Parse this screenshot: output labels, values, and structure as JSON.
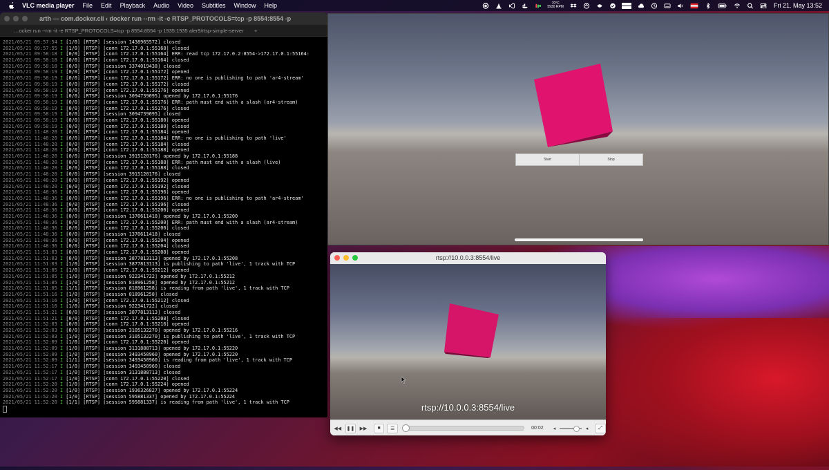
{
  "menubar": {
    "app_name": "VLC media player",
    "items": [
      "File",
      "Edit",
      "Playback",
      "Audio",
      "Video",
      "Subtitles",
      "Window",
      "Help"
    ],
    "temperature": "70°C",
    "fan": "5930 RPM",
    "clock": "Fri 21. May  13:52"
  },
  "terminal": {
    "title": "arth — com.docker.cli ‹ docker run --rm -it -e RTSP_PROTOCOLS=tcp -p 8554:8554 -p",
    "tab": "…ocker run --rm -it -e RTSP_PROTOCOLS=tcp -p 8554:8554 -p 1935:1935 aler9/rtsp-simple-server",
    "plus": "+",
    "lines": [
      [
        "2021/05/21 09:57:54",
        "I",
        "[1/0] [RTSP] [session 1438965572] closed"
      ],
      [
        "2021/05/21 09:57:55",
        "I",
        "[1/0] [RTSP] [conn 172.17.0.1:55168] closed"
      ],
      [
        "2021/05/21 09:58:18",
        "I",
        "[0/0] [RTSP] [conn 172.17.0.1:55164] ERR: read tcp 172.17.0.2:8554->172.17.0.1:55164:"
      ],
      [
        "2021/05/21 09:58:18",
        "I",
        "[0/0] [RTSP] [conn 172.17.0.1:55164] closed"
      ],
      [
        "2021/05/21 09:58:18",
        "I",
        "[0/0] [RTSP] [session 3374019438] closed"
      ],
      [
        "2021/05/21 09:58:19",
        "I",
        "[0/0] [RTSP] [conn 172.17.0.1:55172] opened"
      ],
      [
        "2021/05/21 09:58:19",
        "I",
        "[0/0] [RTSP] [conn 172.17.0.1:55172] ERR: no one is publishing to path 'ar4-stream'"
      ],
      [
        "2021/05/21 09:58:19",
        "I",
        "[0/0] [RTSP] [conn 172.17.0.1:55172] closed"
      ],
      [
        "2021/05/21 09:58:19",
        "I",
        "[0/0] [RTSP] [conn 172.17.0.1:55176] opened"
      ],
      [
        "2021/05/21 09:58:19",
        "I",
        "[0/0] [RTSP] [session 3094739095] opened by 172.17.0.1:55176"
      ],
      [
        "2021/05/21 09:58:19",
        "I",
        "[0/0] [RTSP] [conn 172.17.0.1:55176] ERR: path must end with a slash (ar4-stream)"
      ],
      [
        "2021/05/21 09:58:19",
        "I",
        "[0/0] [RTSP] [conn 172.17.0.1:55176] closed"
      ],
      [
        "2021/05/21 09:58:19",
        "I",
        "[0/0] [RTSP] [session 3094739095] closed"
      ],
      [
        "2021/05/21 09:58:19",
        "I",
        "[0/0] [RTSP] [conn 172.17.0.1:55180] opened"
      ],
      [
        "2021/05/21 09:58:19",
        "I",
        "[0/0] [RTSP] [conn 172.17.0.1:55180] closed"
      ],
      [
        "2021/05/21 11:48:20",
        "I",
        "[0/0] [RTSP] [conn 172.17.0.1:55184] opened"
      ],
      [
        "2021/05/21 11:48:20",
        "I",
        "[0/0] [RTSP] [conn 172.17.0.1:55184] ERR: no one is publishing to path 'live'"
      ],
      [
        "2021/05/21 11:48:20",
        "I",
        "[0/0] [RTSP] [conn 172.17.0.1:55184] closed"
      ],
      [
        "2021/05/21 11:48:20",
        "I",
        "[0/0] [RTSP] [conn 172.17.0.1:55188] opened"
      ],
      [
        "2021/05/21 11:48:20",
        "I",
        "[0/0] [RTSP] [session 3915120176] opened by 172.17.0.1:55188"
      ],
      [
        "2021/05/21 11:48:20",
        "I",
        "[0/0] [RTSP] [conn 172.17.0.1:55188] ERR: path must end with a slash (live)"
      ],
      [
        "2021/05/21 11:48:20",
        "I",
        "[0/0] [RTSP] [conn 172.17.0.1:55188] closed"
      ],
      [
        "2021/05/21 11:48:20",
        "I",
        "[0/0] [RTSP] [session 3915120176] closed"
      ],
      [
        "2021/05/21 11:48:20",
        "I",
        "[0/0] [RTSP] [conn 172.17.0.1:55192] opened"
      ],
      [
        "2021/05/21 11:48:20",
        "I",
        "[0/0] [RTSP] [conn 172.17.0.1:55192] closed"
      ],
      [
        "2021/05/21 11:48:36",
        "I",
        "[0/0] [RTSP] [conn 172.17.0.1:55196] opened"
      ],
      [
        "2021/05/21 11:48:36",
        "I",
        "[0/0] [RTSP] [conn 172.17.0.1:55196] ERR: no one is publishing to path 'ar4-stream'"
      ],
      [
        "2021/05/21 11:48:36",
        "I",
        "[0/0] [RTSP] [conn 172.17.0.1:55196] closed"
      ],
      [
        "2021/05/21 11:48:36",
        "I",
        "[0/0] [RTSP] [conn 172.17.0.1:55200] opened"
      ],
      [
        "2021/05/21 11:48:36",
        "I",
        "[0/0] [RTSP] [session 1370611418] opened by 172.17.0.1:55200"
      ],
      [
        "2021/05/21 11:48:36",
        "I",
        "[0/0] [RTSP] [conn 172.17.0.1:55200] ERR: path must end with a slash (ar4-stream)"
      ],
      [
        "2021/05/21 11:48:36",
        "I",
        "[0/0] [RTSP] [conn 172.17.0.1:55200] closed"
      ],
      [
        "2021/05/21 11:48:36",
        "I",
        "[0/0] [RTSP] [session 1370611418] closed"
      ],
      [
        "2021/05/21 11:48:36",
        "I",
        "[0/0] [RTSP] [conn 172.17.0.1:55204] opened"
      ],
      [
        "2021/05/21 11:48:36",
        "I",
        "[0/0] [RTSP] [conn 172.17.0.1:55204] closed"
      ],
      [
        "2021/05/21 11:51:03",
        "I",
        "[0/0] [RTSP] [conn 172.17.0.1:55208] opened"
      ],
      [
        "2021/05/21 11:51:03",
        "I",
        "[0/0] [RTSP] [session 3877813113] opened by 172.17.0.1:55208"
      ],
      [
        "2021/05/21 11:51:03",
        "I",
        "[1/0] [RTSP] [session 3877813113] is publishing to path 'live', 1 track with TCP"
      ],
      [
        "2021/05/21 11:51:05",
        "I",
        "[1/0] [RTSP] [conn 172.17.0.1:55212] opened"
      ],
      [
        "2021/05/21 11:51:05",
        "I",
        "[1/0] [RTSP] [session 922341722] opened by 172.17.0.1:55212"
      ],
      [
        "2021/05/21 11:51:05",
        "I",
        "[1/0] [RTSP] [session 818961258] opened by 172.17.0.1:55212"
      ],
      [
        "2021/05/21 11:51:05",
        "I",
        "[1/1] [RTSP] [session 818961258] is reading from path 'live', 1 track with TCP"
      ],
      [
        "2021/05/21 11:51:16",
        "I",
        "[1/0] [RTSP] [session 818961258] closed"
      ],
      [
        "2021/05/21 11:51:16",
        "I",
        "[1/0] [RTSP] [conn 172.17.0.1:55212] closed"
      ],
      [
        "2021/05/21 11:51:16",
        "I",
        "[1/0] [RTSP] [session 922341722] closed"
      ],
      [
        "2021/05/21 11:51:21",
        "I",
        "[0/0] [RTSP] [session 3877813113] closed"
      ],
      [
        "2021/05/21 11:51:21",
        "I",
        "[0/0] [RTSP] [conn 172.17.0.1:55208] closed"
      ],
      [
        "2021/05/21 11:52:03",
        "I",
        "[0/0] [RTSP] [conn 172.17.0.1:55216] opened"
      ],
      [
        "2021/05/21 11:52:03",
        "I",
        "[0/0] [RTSP] [session 3105132270] opened by 172.17.0.1:55216"
      ],
      [
        "2021/05/21 11:52:03",
        "I",
        "[1/0] [RTSP] [session 3105132270] is publishing to path 'live', 1 track with TCP"
      ],
      [
        "2021/05/21 11:52:09",
        "I",
        "[1/0] [RTSP] [conn 172.17.0.1:55220] opened"
      ],
      [
        "2021/05/21 11:52:09",
        "I",
        "[1/0] [RTSP] [session 3131888713] opened by 172.17.0.1:55220"
      ],
      [
        "2021/05/21 11:52:09",
        "I",
        "[1/0] [RTSP] [session 3493450960] opened by 172.17.0.1:55220"
      ],
      [
        "2021/05/21 11:52:09",
        "I",
        "[1/1] [RTSP] [session 3493450960] is reading from path 'live', 1 track with TCP"
      ],
      [
        "2021/05/21 11:52:17",
        "I",
        "[1/0] [RTSP] [session 3493450960] closed"
      ],
      [
        "2021/05/21 11:52:17",
        "I",
        "[1/0] [RTSP] [session 3131888713] closed"
      ],
      [
        "2021/05/21 11:52:17",
        "I",
        "[1/0] [RTSP] [conn 172.17.0.1:55220] closed"
      ],
      [
        "2021/05/21 11:52:20",
        "I",
        "[1/0] [RTSP] [conn 172.17.0.1:55224] opened"
      ],
      [
        "2021/05/21 11:52:20",
        "I",
        "[1/0] [RTSP] [session 1936326827] opened by 172.17.0.1:55224"
      ],
      [
        "2021/05/21 11:52:20",
        "I",
        "[1/0] [RTSP] [session 595881337] opened by 172.17.0.1:55224"
      ],
      [
        "2021/05/21 11:52:20",
        "I",
        "[1/1] [RTSP] [session 595881337] is reading from path 'live', 1 track with TCP"
      ]
    ]
  },
  "game": {
    "start_label": "Start",
    "stop_label": "Stop",
    "cube_color": "#e0146e"
  },
  "vlc": {
    "title": "rtsp://10.0.0.3:8554/live",
    "overlay": "rtsp://10.0.0.3:8554/live",
    "time": "00:02",
    "progress": 0.0,
    "volume": 0.7
  }
}
